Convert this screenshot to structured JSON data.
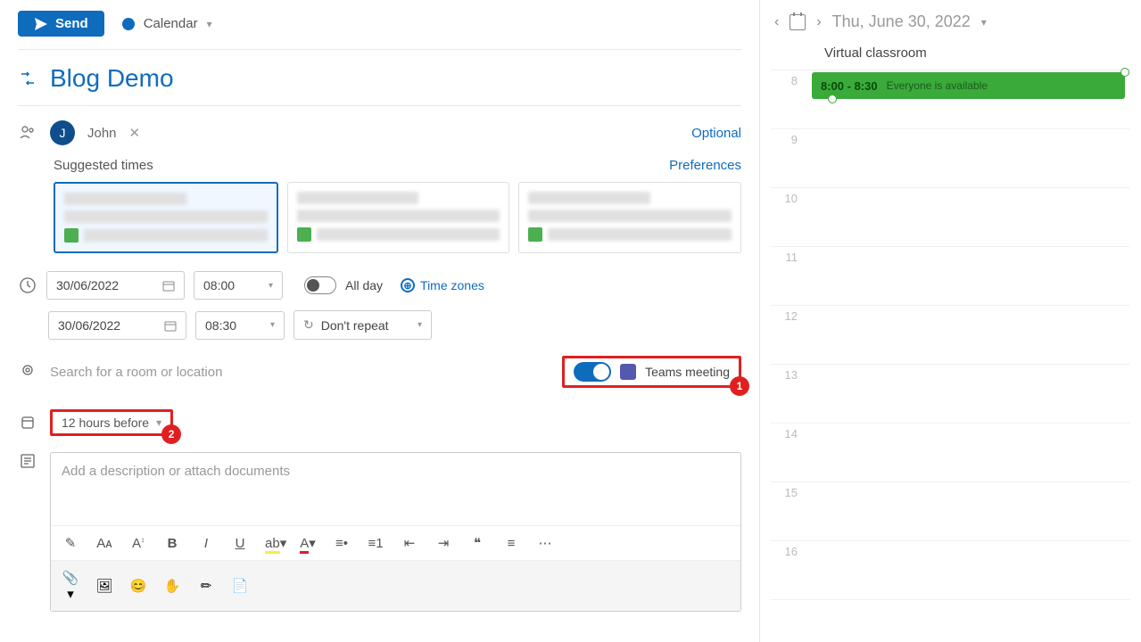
{
  "toolbar": {
    "send_label": "Send",
    "calendar_label": "Calendar"
  },
  "event": {
    "title": "Blog Demo"
  },
  "attendees": {
    "items": [
      {
        "initial": "J",
        "name": "John"
      }
    ],
    "optional_label": "Optional"
  },
  "suggested": {
    "header": "Suggested times",
    "prefs": "Preferences"
  },
  "datetime": {
    "start_date": "30/06/2022",
    "start_time": "08:00",
    "end_date": "30/06/2022",
    "end_time": "08:30",
    "allday_label": "All day",
    "timezones_label": "Time zones",
    "repeat_label": "Don't repeat"
  },
  "location": {
    "placeholder": "Search for a room or location",
    "teams_label": "Teams meeting"
  },
  "reminder": {
    "value": "12 hours before"
  },
  "description": {
    "placeholder": "Add a description or attach documents"
  },
  "sidepanel": {
    "date": "Thu, June 30, 2022",
    "room": "Virtual classroom",
    "event_time": "8:00 - 8:30",
    "event_status": "Everyone is available",
    "hours": [
      "8",
      "9",
      "10",
      "11",
      "12",
      "13",
      "14",
      "15",
      "16"
    ]
  },
  "annotations": {
    "badge1": "1",
    "badge2": "2"
  }
}
